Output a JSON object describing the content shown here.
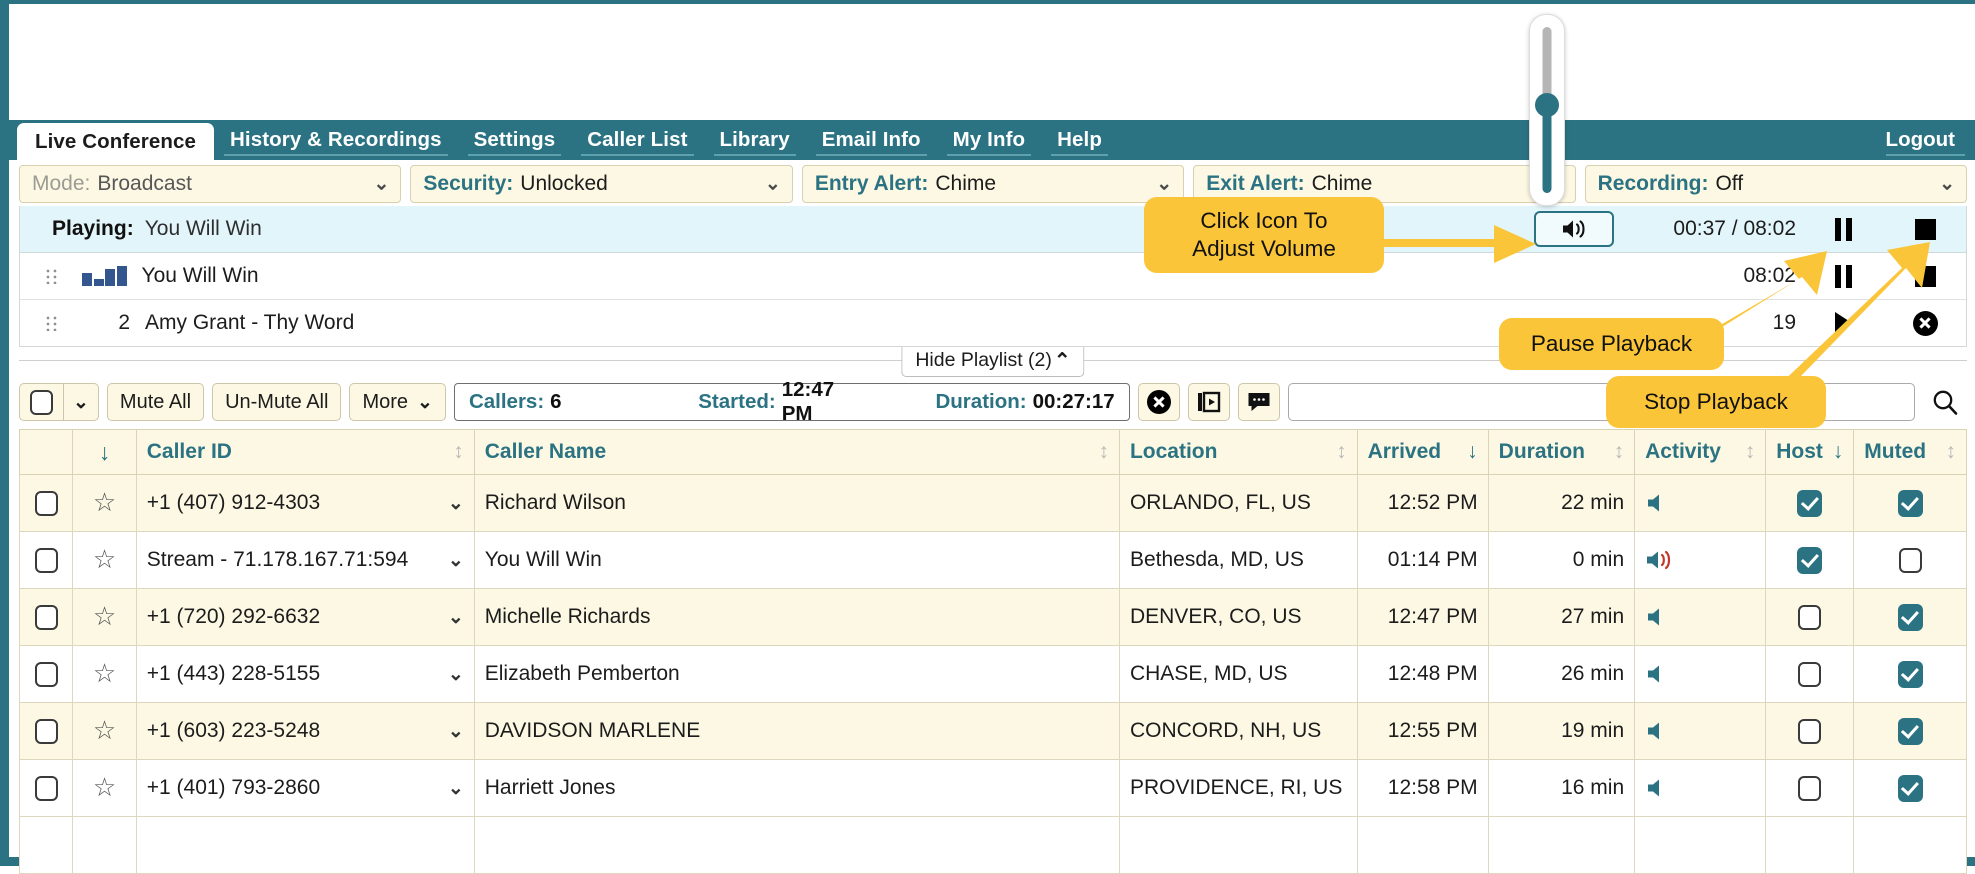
{
  "nav": {
    "tabs": [
      {
        "label": "Live Conference",
        "active": true
      },
      {
        "label": "History & Recordings",
        "active": false
      },
      {
        "label": "Settings",
        "active": false
      },
      {
        "label": "Caller List",
        "active": false
      },
      {
        "label": "Library",
        "active": false
      },
      {
        "label": "Email Info",
        "active": false
      },
      {
        "label": "My Info",
        "active": false
      },
      {
        "label": "Help",
        "active": false
      }
    ],
    "logout": "Logout"
  },
  "selectors": [
    {
      "label": "Mode:",
      "value": "Broadcast",
      "dim": true
    },
    {
      "label": "Security:",
      "value": "Unlocked",
      "dim": false
    },
    {
      "label": "Entry Alert:",
      "value": "Chime",
      "dim": false
    },
    {
      "label": "Exit Alert:",
      "value": "Chime",
      "dim": false
    },
    {
      "label": "Recording:",
      "value": "Off",
      "dim": false
    }
  ],
  "player": {
    "playing_label": "Playing:",
    "playing_title": "You Will Win",
    "time": "00:37 / 08:02",
    "volume_icon": "speaker-icon"
  },
  "playlist": {
    "toggle_label": "Hide Playlist (2)",
    "items": [
      {
        "num": "",
        "title": "You Will Win",
        "time": "08:02",
        "playing": true
      },
      {
        "num": "2",
        "title": "Amy Grant - Thy Word",
        "time": "19",
        "playing": false
      }
    ]
  },
  "toolbar": {
    "mute_all": "Mute All",
    "un_mute_all": "Un-Mute All",
    "more": "More",
    "callers_label": "Callers:",
    "callers_value": "6",
    "started_label": "Started:",
    "started_value": "12:47 PM",
    "duration_label": "Duration:",
    "duration_value": "00:27:17",
    "search_placeholder": ""
  },
  "table": {
    "columns": [
      {
        "label": "",
        "sort": "none"
      },
      {
        "label": "",
        "sort": "down"
      },
      {
        "label": "Caller ID",
        "sort": "both"
      },
      {
        "label": "Caller Name",
        "sort": "both"
      },
      {
        "label": "Location",
        "sort": "both"
      },
      {
        "label": "Arrived",
        "sort": "down"
      },
      {
        "label": "Duration",
        "sort": "both"
      },
      {
        "label": "Activity",
        "sort": "both"
      },
      {
        "label": "Host",
        "sort": "down"
      },
      {
        "label": "Muted",
        "sort": "both"
      }
    ],
    "rows": [
      {
        "caller_id": "+1 (407) 912-4303",
        "caller_name": "Richard Wilson",
        "location": "ORLANDO, FL, US",
        "arrived": "12:52 PM",
        "duration": "22 min",
        "activity": "speaker-muted-icon",
        "host": true,
        "muted": true
      },
      {
        "caller_id": "Stream - 71.178.167.71:594",
        "caller_name": "You Will Win",
        "location": "Bethesda, MD, US",
        "arrived": "01:14 PM",
        "duration": "0 min",
        "activity": "speaker-active-icon",
        "host": true,
        "muted": false
      },
      {
        "caller_id": "+1 (720) 292-6632",
        "caller_name": "Michelle Richards",
        "location": "DENVER, CO, US",
        "arrived": "12:47 PM",
        "duration": "27 min",
        "activity": "speaker-muted-icon",
        "host": false,
        "muted": true
      },
      {
        "caller_id": "+1 (443) 228-5155",
        "caller_name": "Elizabeth Pemberton",
        "location": "CHASE, MD, US",
        "arrived": "12:48 PM",
        "duration": "26 min",
        "activity": "speaker-muted-icon",
        "host": false,
        "muted": true
      },
      {
        "caller_id": "+1 (603) 223-5248",
        "caller_name": "DAVIDSON MARLENE",
        "location": "CONCORD, NH, US",
        "arrived": "12:55 PM",
        "duration": "19 min",
        "activity": "speaker-muted-icon",
        "host": false,
        "muted": true
      },
      {
        "caller_id": "+1 (401) 793-2860",
        "caller_name": "Harriett Jones",
        "location": "PROVIDENCE, RI, US",
        "arrived": "12:58 PM",
        "duration": "16 min",
        "activity": "speaker-muted-icon",
        "host": false,
        "muted": true
      }
    ]
  },
  "callouts": [
    {
      "id": "volume",
      "line1": "Click Icon To",
      "line2": "Adjust Volume"
    },
    {
      "id": "pause",
      "line1": "Pause Playback",
      "line2": ""
    },
    {
      "id": "stop",
      "line1": "Stop Playback",
      "line2": ""
    }
  ],
  "colors": {
    "brand": "#2b7383",
    "callout": "#fac539",
    "row_alt": "#fcf8e3",
    "playing_row": "#e2f5fb"
  }
}
